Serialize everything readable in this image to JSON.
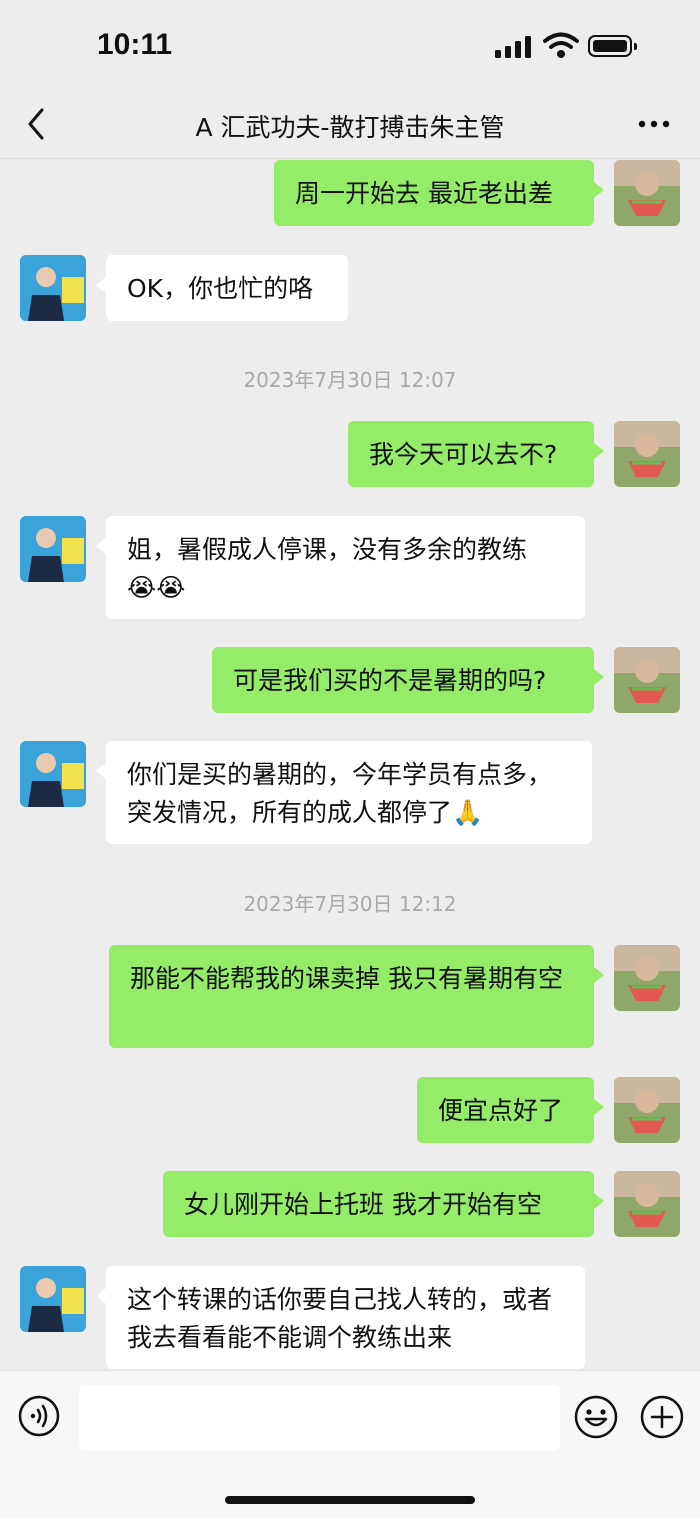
{
  "status_bar": {
    "time": "10:11"
  },
  "header": {
    "title": "A 汇武功夫-散打搏击朱主管"
  },
  "messages": [
    {
      "text": "周一开始去 最近老出差"
    },
    {
      "text": "OK，你也忙的咯"
    },
    {
      "text": "2023年7月30日 12:07"
    },
    {
      "text": "我今天可以去不?"
    },
    {
      "text": "姐，暑假成人停课，没有多余的教练",
      "emoji": "😭😭"
    },
    {
      "text": "可是我们买的不是暑期的吗?"
    },
    {
      "text": "你们是买的暑期的，今年学员有点多，突发情况，所有的成人都停了",
      "emoji": "🙏"
    },
    {
      "text": "2023年7月30日 12:12"
    },
    {
      "text": "那能不能帮我的课卖掉 我只有暑期有空"
    },
    {
      "text": "便宜点好了"
    },
    {
      "text": "女儿刚开始上托班 我才开始有空"
    },
    {
      "text": "这个转课的话你要自己找人转的，或者我去看看能不能调个教练出来"
    }
  ],
  "icons": {
    "back": "chevron-left-icon",
    "more": "more-dots-icon",
    "voice": "voice-input-icon",
    "emoji": "emoji-icon",
    "plus": "plus-icon"
  },
  "colors": {
    "sent_bubble": "#95ec69",
    "received_bubble": "#ffffff",
    "background": "#ededed"
  }
}
